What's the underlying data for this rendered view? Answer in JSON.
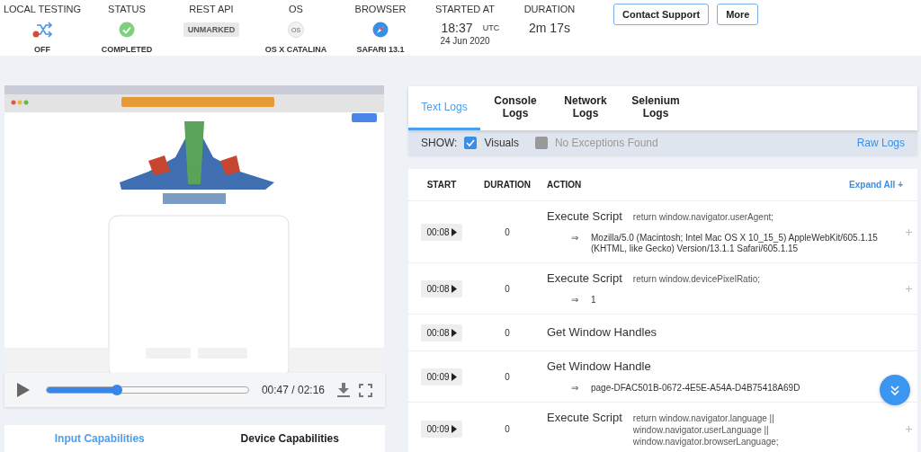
{
  "header": [
    {
      "label": "LOCAL TESTING",
      "kind": "local",
      "value": "OFF"
    },
    {
      "label": "STATUS",
      "kind": "status",
      "value": "COMPLETED"
    },
    {
      "label": "REST API",
      "kind": "badge",
      "badge": "UNMARKED"
    },
    {
      "label": "OS",
      "kind": "os",
      "icon_text": "OS",
      "value": "OS X CATALINA"
    },
    {
      "label": "BROWSER",
      "kind": "browser",
      "value": "SAFARI 13.1"
    },
    {
      "label": "STARTED AT",
      "kind": "time",
      "time": "18:37",
      "zone": "UTC",
      "date": "24 Jun 2020"
    },
    {
      "label": "DURATION",
      "kind": "duration",
      "time": "2m 17s"
    }
  ],
  "header_buttons": [
    "Contact Support",
    "More"
  ],
  "video": {
    "kind": "picture",
    "player": {
      "level": 0.35,
      "time": "00:47 / 02:16"
    }
  },
  "capability_tabs": [
    {
      "label": "Input Capabilities",
      "selected": true
    },
    {
      "label": "Device Capabilities",
      "selected": false
    }
  ],
  "log_tabs": [
    {
      "label": "Text Logs",
      "selected": true
    },
    {
      "label": "Console Logs",
      "selected": false
    },
    {
      "label": "Network Logs",
      "selected": false
    },
    {
      "label": "Selenium Logs",
      "selected": false
    }
  ],
  "show_bar": {
    "label": "SHOW:",
    "options": [
      {
        "label": "Visuals",
        "checked": true,
        "disabled": false
      },
      {
        "label": "No Exceptions Found",
        "checked": false,
        "disabled": true
      }
    ],
    "link": "Raw Logs"
  },
  "table": {
    "columns": [
      "START",
      "DURATION",
      "ACTION"
    ],
    "expand_all": "Expand All +",
    "rows": [
      {
        "start": "00:08",
        "duration": "0",
        "action": "Execute Script",
        "detail": "return window.navigator.userAgent;",
        "results": [
          {
            "arrow": "⇒",
            "text": "Mozilla/5.0 (Macintosh; Intel Mac OS X 10_15_5) AppleWebKit/605.1.15 (KHTML, like Gecko) Version/13.1.1 Safari/605.1.15"
          }
        ],
        "expandable": true
      },
      {
        "start": "00:08",
        "duration": "0",
        "action": "Execute Script",
        "detail": "return window.devicePixelRatio;",
        "results": [
          {
            "arrow": "⇒",
            "text": "1"
          }
        ],
        "expandable": true
      },
      {
        "start": "00:08",
        "duration": "0",
        "action": "Get Window Handles",
        "expandable": false
      },
      {
        "start": "00:09",
        "duration": "0",
        "action": "Get Window Handle",
        "results": [
          {
            "arrow": "⇒",
            "text": "page-DFAC501B-0672-4E5E-A54A-D4B75418A69D"
          }
        ],
        "expandable": false
      },
      {
        "start": "00:09",
        "duration": "0",
        "action": "Execute Script",
        "detail": "return window.navigator.language || window.navigator.userLanguage || window.navigator.browserLanguage;",
        "expandable": true
      }
    ]
  }
}
